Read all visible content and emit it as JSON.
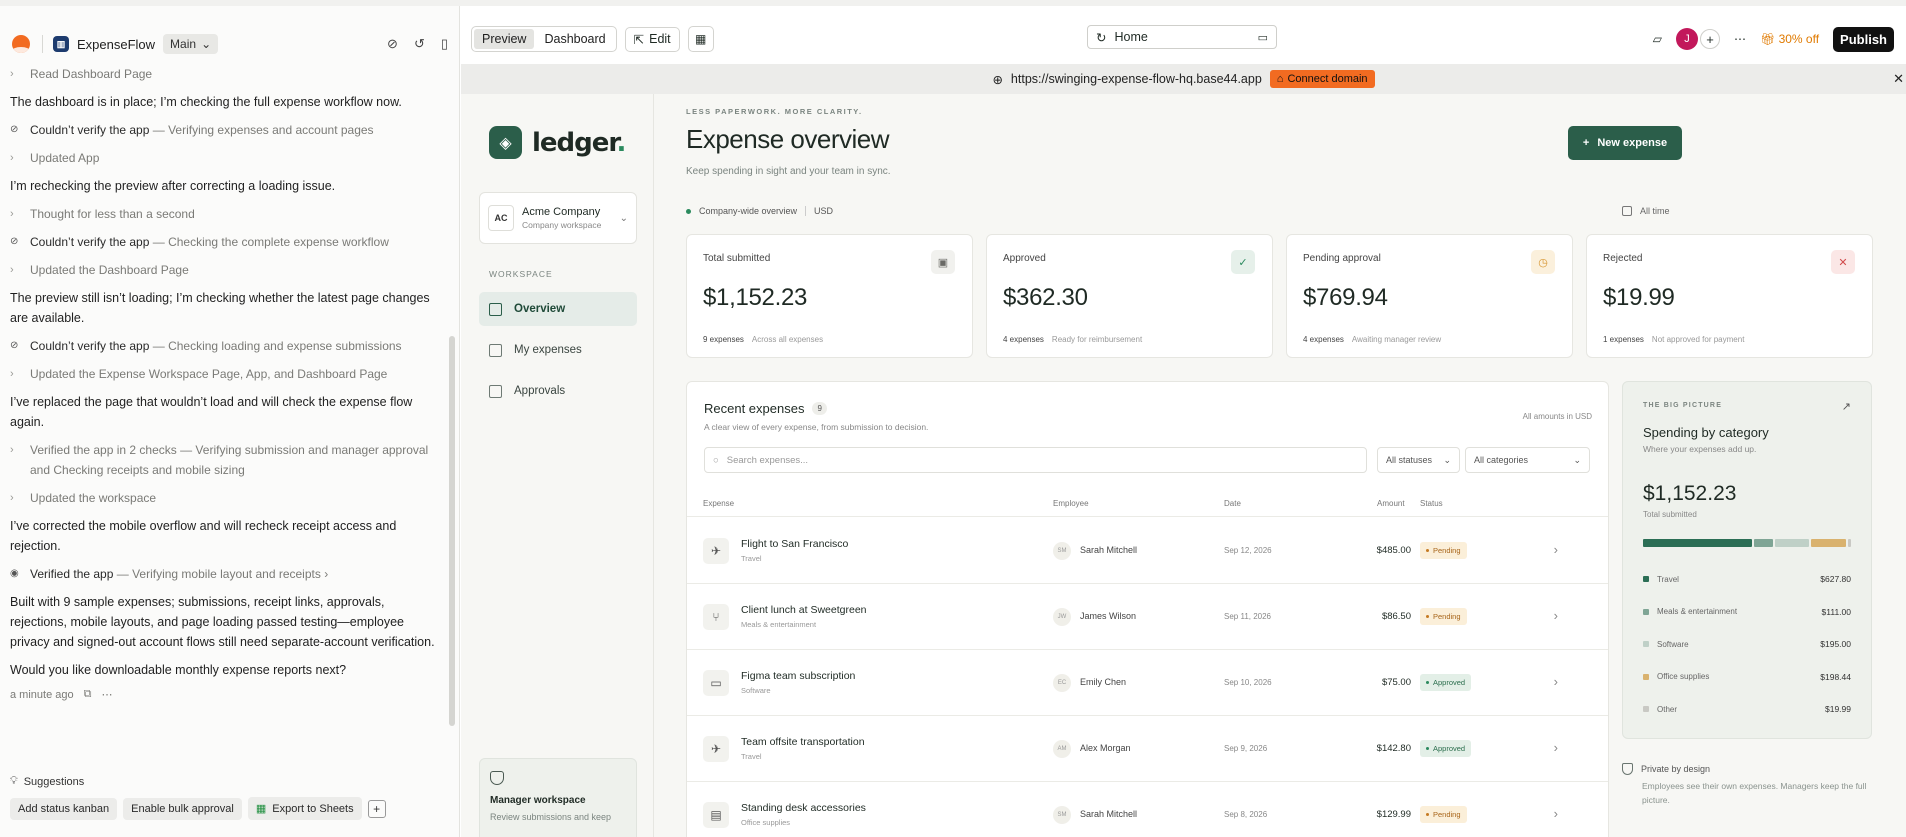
{
  "topbar": {
    "app_name": "ExpenseFlow",
    "branch": "Main",
    "preview_label": "Preview",
    "dashboard_label": "Dashboard",
    "edit_label": "Edit",
    "route": "Home",
    "offer": "30% off",
    "publish_label": "Publish",
    "avatar_initial": "J"
  },
  "urlbar": {
    "url": "https://swinging-expense-flow-hq.base44.app",
    "connect_label": "Connect domain"
  },
  "chat": {
    "entries": [
      {
        "kind": "step",
        "text": "Read Dashboard Page"
      },
      {
        "kind": "text",
        "text": "The dashboard is in place; I’m checking the full expense workflow now."
      },
      {
        "kind": "warn",
        "strong": "Couldn’t verify the app",
        "text": " — Verifying expenses and account pages"
      },
      {
        "kind": "step",
        "text": "Updated App"
      },
      {
        "kind": "text",
        "text": "I’m rechecking the preview after correcting a loading issue."
      },
      {
        "kind": "step",
        "text": "Thought for less than a second"
      },
      {
        "kind": "warn",
        "strong": "Couldn’t verify the app",
        "text": " — Checking the complete expense workflow"
      },
      {
        "kind": "step",
        "text": "Updated the Dashboard Page"
      },
      {
        "kind": "text",
        "text": "The preview still isn’t loading; I’m checking whether the latest page changes are available."
      },
      {
        "kind": "warn",
        "strong": "Couldn’t verify the app",
        "text": " — Checking loading and expense submissions"
      },
      {
        "kind": "step",
        "text": "Updated the Expense Workspace Page, App, and Dashboard Page"
      },
      {
        "kind": "text",
        "text": "I’ve replaced the page that wouldn’t load and will check the expense flow again."
      },
      {
        "kind": "step",
        "text": "Verified the app in 2 checks — Verifying submission and manager approval and Checking receipts and mobile sizing"
      },
      {
        "kind": "step",
        "text": "Updated the workspace"
      },
      {
        "kind": "text",
        "text": "I’ve corrected the mobile overflow and will recheck receipt access and rejection."
      },
      {
        "kind": "ok",
        "strong": "Verified the app",
        "text": " — Verifying mobile layout and receipts"
      },
      {
        "kind": "text",
        "text": "Built with 9 sample expenses; submissions, receipt links, approvals, rejections, mobile layouts, and page loading passed testing—employee privacy and signed-out account flows still need separate-account verification."
      },
      {
        "kind": "text",
        "text": "Would you like downloadable monthly expense reports next?"
      }
    ],
    "timestamp": "a minute ago",
    "suggestions_title": "Suggestions",
    "suggestions": [
      "Add status kanban",
      "Enable bulk approval",
      "Export to Sheets"
    ]
  },
  "app": {
    "brand": "ledger",
    "company_initials": "AC",
    "company_name": "Acme Company",
    "company_sub": "Company workspace",
    "workspace_label": "WORKSPACE",
    "nav": [
      "Overview",
      "My expenses",
      "Approvals"
    ],
    "manager_title": "Manager workspace",
    "manager_sub": "Review submissions and keep",
    "eyebrow": "LESS PAPERWORK. MORE CLARITY.",
    "title": "Expense overview",
    "subtitle": "Keep spending in sight and your team in sync.",
    "new_expense": "New expense",
    "scope": "Company-wide overview",
    "currency": "USD",
    "range": "All time",
    "cards": [
      {
        "label": "Total submitted",
        "value": "$1,152.23",
        "count": "9 expenses",
        "note": "Across all expenses",
        "color": "#6a6a66",
        "bg": "#f1f1ee"
      },
      {
        "label": "Approved",
        "value": "$362.30",
        "count": "4 expenses",
        "note": "Ready for reimbursement",
        "color": "#2b8a5e",
        "bg": "#e6f0ea"
      },
      {
        "label": "Pending approval",
        "value": "$769.94",
        "count": "4 expenses",
        "note": "Awaiting manager review",
        "color": "#d6922a",
        "bg": "#fbf0dc"
      },
      {
        "label": "Rejected",
        "value": "$19.99",
        "count": "1 expenses",
        "note": "Not approved for payment",
        "color": "#d14b4b",
        "bg": "#fbe7e6"
      }
    ],
    "recent": {
      "title": "Recent expenses",
      "count": "9",
      "subtitle": "A clear view of every expense, from submission to decision.",
      "amounts_note": "All amounts in USD",
      "search_placeholder": "Search expenses...",
      "status_filter": "All statuses",
      "category_filter": "All categories",
      "headers": {
        "expense": "Expense",
        "employee": "Employee",
        "date": "Date",
        "amount": "Amount",
        "status": "Status"
      },
      "rows": [
        {
          "icon": "plane-icon",
          "title": "Flight to San Francisco",
          "category": "Travel",
          "initials": "SM",
          "employee": "Sarah Mitchell",
          "date": "Sep 12, 2026",
          "amount": "$485.00",
          "status": "Pending"
        },
        {
          "icon": "utensils-icon",
          "title": "Client lunch at Sweetgreen",
          "category": "Meals & entertainment",
          "initials": "JW",
          "employee": "James Wilson",
          "date": "Sep 11, 2026",
          "amount": "$86.50",
          "status": "Pending"
        },
        {
          "icon": "monitor-icon",
          "title": "Figma team subscription",
          "category": "Software",
          "initials": "EC",
          "employee": "Emily Chen",
          "date": "Sep 10, 2026",
          "amount": "$75.00",
          "status": "Approved"
        },
        {
          "icon": "plane-icon",
          "title": "Team offsite transportation",
          "category": "Travel",
          "initials": "AM",
          "employee": "Alex Morgan",
          "date": "Sep 9, 2026",
          "amount": "$142.80",
          "status": "Approved"
        },
        {
          "icon": "briefcase-icon",
          "title": "Standing desk accessories",
          "category": "Office supplies",
          "initials": "SM",
          "employee": "Sarah Mitchell",
          "date": "Sep 8, 2026",
          "amount": "$129.99",
          "status": "Pending"
        }
      ]
    },
    "big_picture": {
      "eyebrow": "THE BIG PICTURE",
      "title": "Spending by category",
      "subtitle": "Where your expenses add up.",
      "total": "$1,152.23",
      "total_label": "Total submitted",
      "categories": [
        {
          "name": "Travel",
          "value": "$627.80",
          "amount": 627.8,
          "color": "#2b6e55"
        },
        {
          "name": "Meals & entertainment",
          "value": "$111.00",
          "amount": 111.0,
          "color": "#7fa595"
        },
        {
          "name": "Software",
          "value": "$195.00",
          "amount": 195.0,
          "color": "#bfd0c7"
        },
        {
          "name": "Office supplies",
          "value": "$198.44",
          "amount": 198.44,
          "color": "#d9b26e"
        },
        {
          "name": "Other",
          "value": "$19.99",
          "amount": 19.99,
          "color": "#c9c9c4"
        }
      ],
      "privacy_title": "Private by design",
      "privacy_text": "Employees see their own expenses. Managers keep the full picture."
    }
  }
}
